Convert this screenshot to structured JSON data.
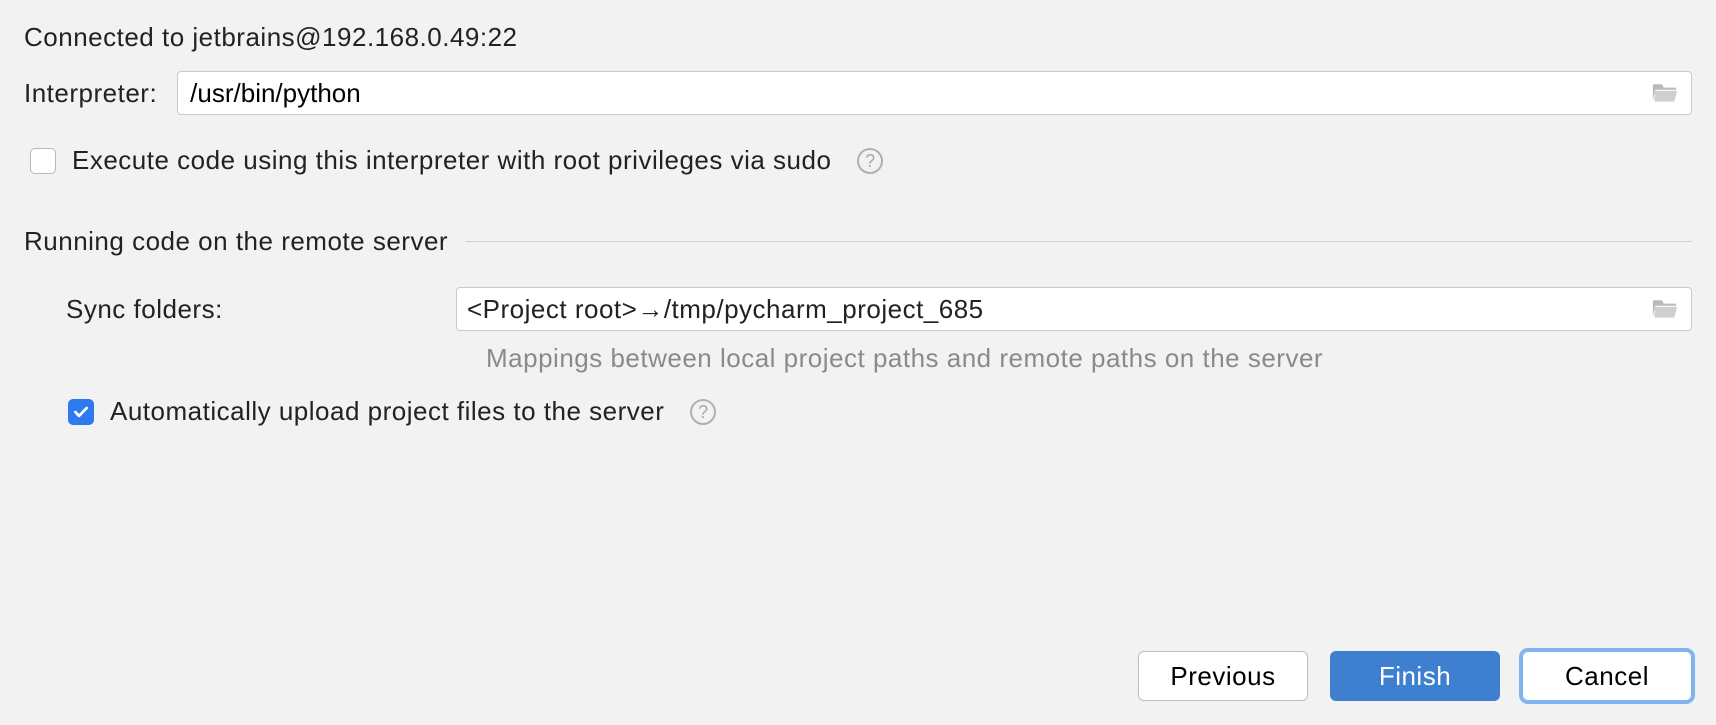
{
  "title": "Connected to jetbrains@192.168.0.49:22",
  "interpreter": {
    "label": "Interpreter:",
    "path": "/usr/bin/python"
  },
  "sudo": {
    "label": "Execute code using this interpreter with root privileges via sudo",
    "checked": false
  },
  "section": {
    "title": "Running code on the remote server",
    "sync_label": "Sync folders:",
    "sync_value": "<Project root>→/tmp/pycharm_project_685",
    "hint": "Mappings between local project paths and remote paths on the server",
    "auto_upload_label": "Automatically upload project files to the server",
    "auto_upload_checked": true
  },
  "buttons": {
    "previous": "Previous",
    "finish": "Finish",
    "cancel": "Cancel"
  },
  "colors": {
    "accent": "#3e7fd0",
    "checkbox_checked": "#2f7af1",
    "background": "#f2f2f2"
  }
}
